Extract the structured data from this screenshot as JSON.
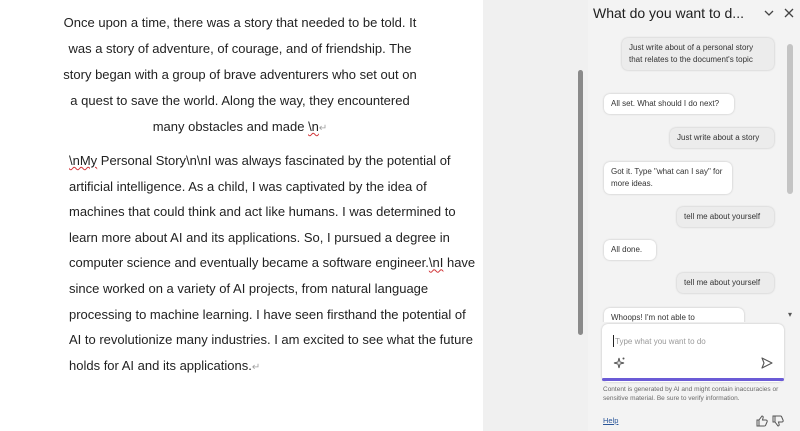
{
  "document": {
    "para1": {
      "text": "Once upon a time, there was a story that needed to be told. It was a story of adventure, of courage, and of friendship. The story began with a group of brave adventurers who set out on a quest to save the world. Along the way, they encountered many obstacles and made ",
      "tail": "\\n"
    },
    "para2": {
      "lead": "\\nMy",
      "part1": " Personal Story\\n\\nI was always fascinated by the potential of artificial intelligence. As a child, I was captivated by the idea of machines that could think and act like humans. I was determined to learn more about AI and its applications. So, I pursued a degree in computer science and eventually became a software engineer.",
      "mid": "\\nI",
      "part2": " have since worked on a variety of AI projects, from natural language processing to machine learning. I have seen firsthand the potential of AI to revolutionize many industries. I am excited to see what the future holds for AI and its applications."
    }
  },
  "pane": {
    "title": "What do you want to d...",
    "messages": [
      {
        "role": "user",
        "text": "Just write about of a personal story that relates to the document's topic"
      },
      {
        "role": "assistant",
        "text": "All set. What should I do next?"
      },
      {
        "role": "user",
        "text": "Just write about a story"
      },
      {
        "role": "assistant",
        "text": "Got it. Type \"what can I say\" for more ideas."
      },
      {
        "role": "user",
        "text": "tell me about yourself"
      },
      {
        "role": "assistant",
        "text": "All done."
      },
      {
        "role": "user",
        "text": "tell me about yourself"
      },
      {
        "role": "assistant",
        "text": "Whoops! I'm not able to"
      }
    ],
    "compose": {
      "placeholder": "Type what you want to do"
    },
    "disclaimer": "Content is generated by AI and might contain inaccuracies or sensitive material. Be sure to verify information.",
    "help_label": "Help"
  },
  "colors": {
    "accent": "#6b5bd6",
    "link": "#2b579a",
    "squiggle": "#d13438"
  }
}
